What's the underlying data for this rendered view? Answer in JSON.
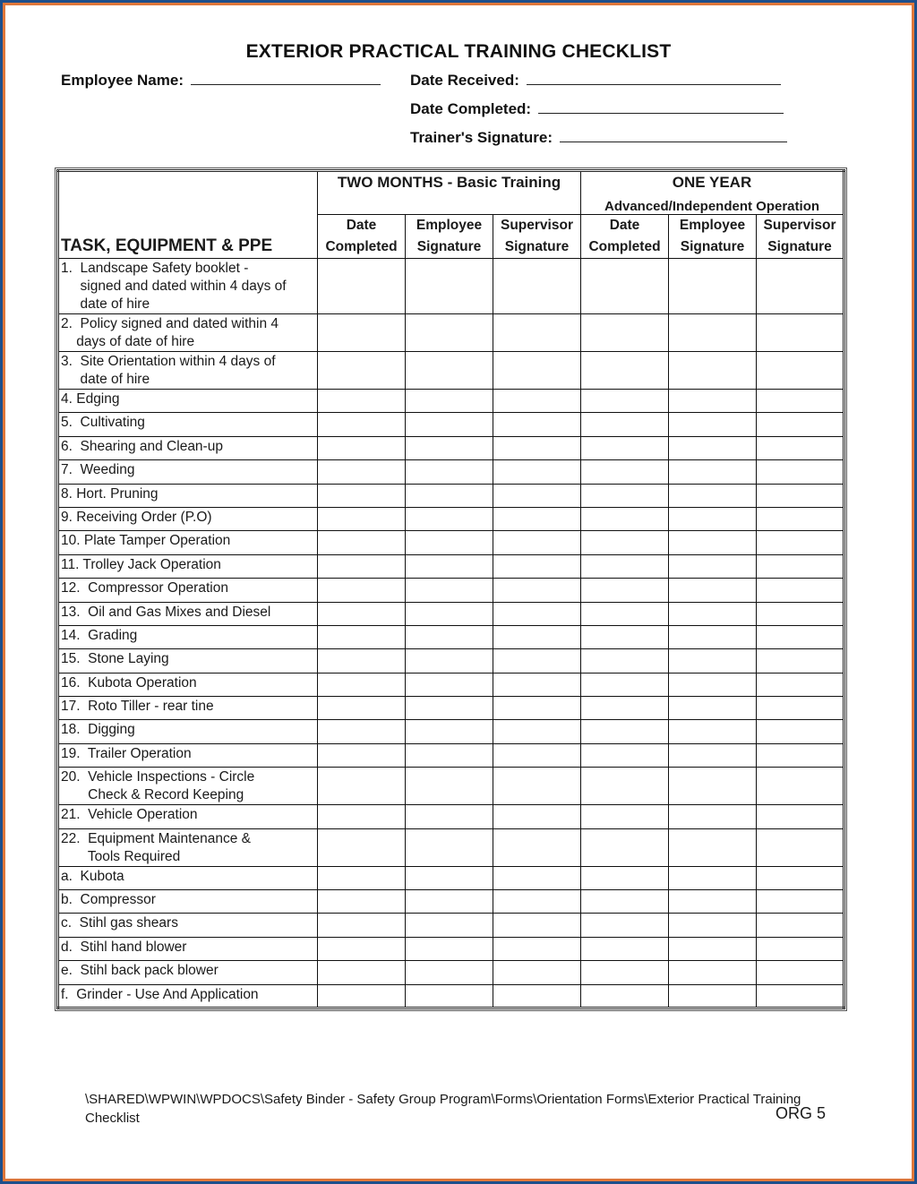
{
  "colors": {
    "frame_outer": "#1d4f8c",
    "frame_inner": "#e0773a",
    "page": "#ffffff",
    "ink": "#111111"
  },
  "document": {
    "title": "EXTERIOR PRACTICAL TRAINING CHECKLIST",
    "fields": {
      "employee_name": "Employee Name:",
      "date_received": "Date Received:",
      "date_completed": "Date Completed:",
      "trainer_signature": "Trainer's Signature:"
    }
  },
  "table": {
    "task_header": "TASK, EQUIPMENT & PPE",
    "groups": [
      {
        "title": "TWO MONTHS - Basic Training",
        "subtitle": ""
      },
      {
        "title": "ONE YEAR",
        "subtitle": "Advanced/Independent Operation"
      }
    ],
    "columns": [
      {
        "line1": "Date",
        "line2": "Completed"
      },
      {
        "line1": "Employee",
        "line2": "Signature"
      },
      {
        "line1": "Supervisor",
        "line2": "Signature"
      },
      {
        "line1": "Date",
        "line2": "Completed"
      },
      {
        "line1": "Employee",
        "line2": "Signature"
      },
      {
        "line1": "Supervisor",
        "line2": "Signature"
      }
    ],
    "rows": [
      "1.  Landscape Safety booklet -\n     signed and dated within 4 days of\n     date of hire",
      "2.  Policy signed and dated within 4\n    days of date of hire",
      "3.  Site Orientation within 4 days of\n     date of hire",
      "4. Edging",
      "5.  Cultivating",
      "6.  Shearing and Clean-up",
      "7.  Weeding",
      "8. Hort. Pruning",
      "9. Receiving Order (P.O)",
      "10. Plate Tamper Operation",
      "11. Trolley Jack Operation",
      "12.  Compressor Operation",
      "13.  Oil and Gas Mixes and Diesel",
      "14.  Grading",
      "15.  Stone Laying",
      "16.  Kubota Operation",
      "17.  Roto Tiller - rear tine",
      "18.  Digging",
      "19.  Trailer Operation",
      "20.  Vehicle Inspections - Circle\n       Check & Record Keeping",
      "21.  Vehicle Operation",
      "22.  Equipment Maintenance &\n       Tools Required",
      "a.  Kubota",
      "b.  Compressor",
      "c.  Stihl gas shears",
      "d.  Stihl hand blower",
      "e.  Stihl back pack blower",
      "f.  Grinder - Use And Application"
    ]
  },
  "footer": {
    "path": "\\SHARED\\WPWIN\\WPDOCS\\Safety Binder - Safety Group Program\\Forms\\Orientation Forms\\Exterior Practical Training Checklist",
    "code": "ORG 5"
  }
}
